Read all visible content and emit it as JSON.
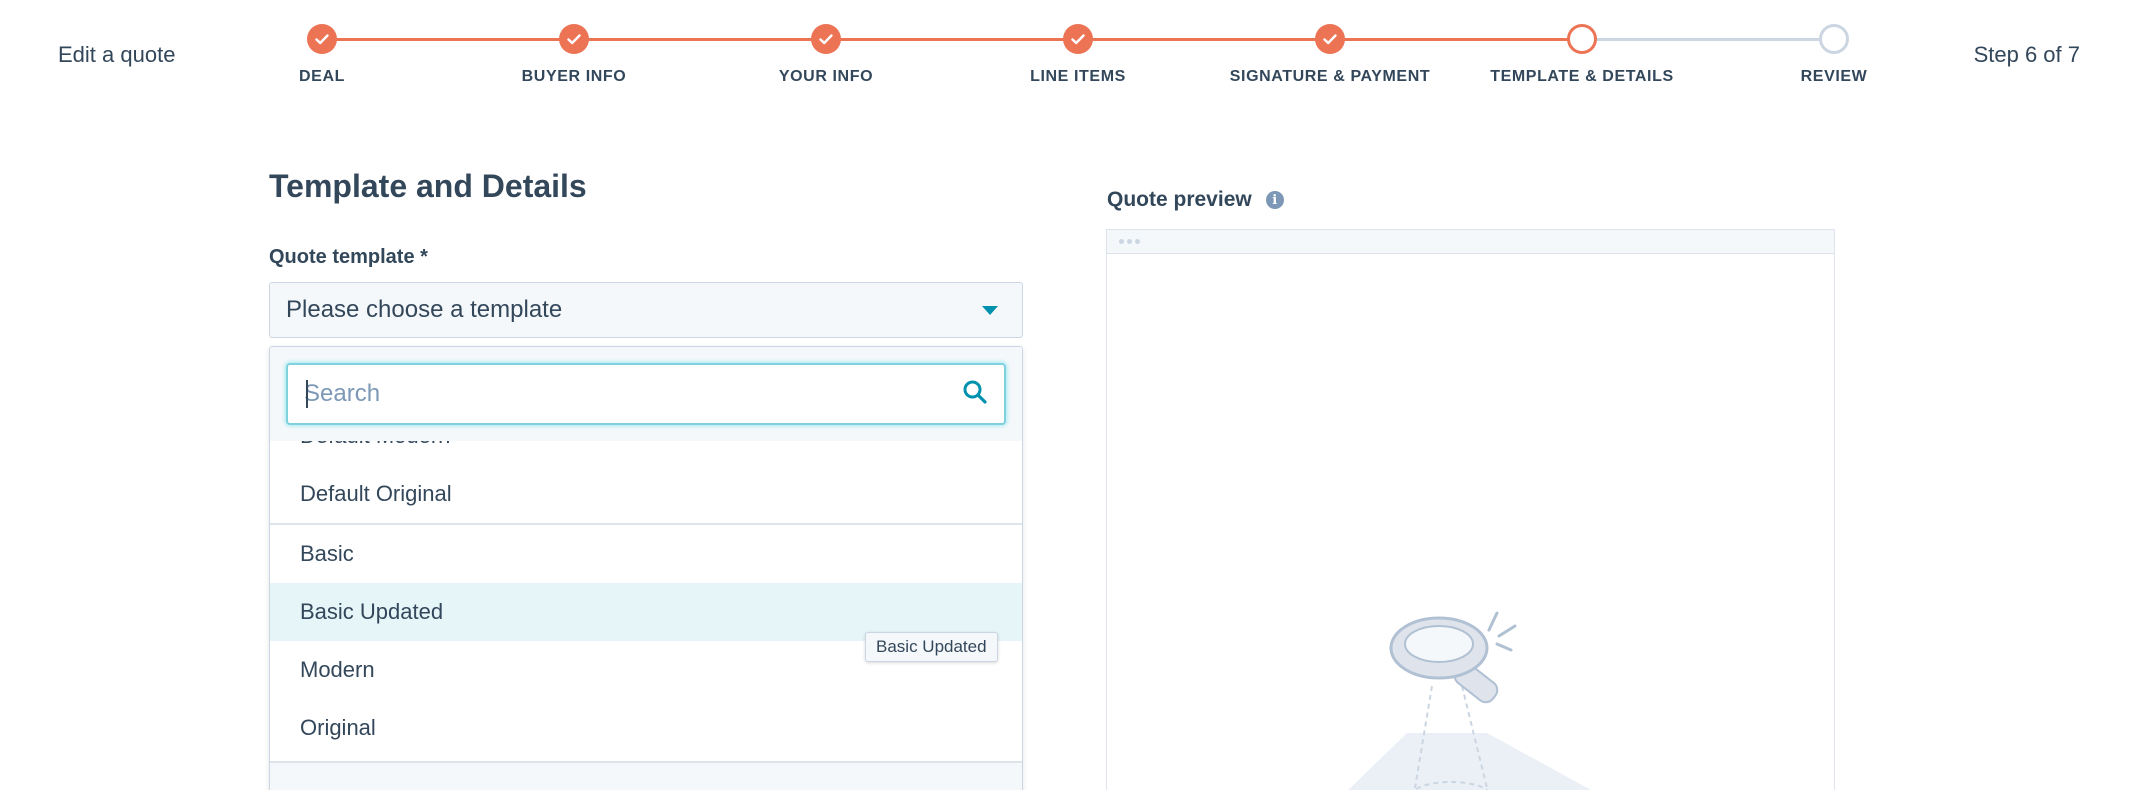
{
  "header": {
    "title": "Edit a quote",
    "step_count": "Step 6 of 7",
    "steps": [
      {
        "label": "DEAL",
        "status": "done"
      },
      {
        "label": "BUYER INFO",
        "status": "done"
      },
      {
        "label": "YOUR INFO",
        "status": "done"
      },
      {
        "label": "LINE ITEMS",
        "status": "done"
      },
      {
        "label": "SIGNATURE & PAYMENT",
        "status": "done"
      },
      {
        "label": "TEMPLATE & DETAILS",
        "status": "current"
      },
      {
        "label": "REVIEW",
        "status": "todo"
      }
    ],
    "accent_color": "#ec7455",
    "pending_color": "#cbd6e2"
  },
  "form": {
    "section_title": "Template and Details",
    "template_label": "Quote template *",
    "template_select_value": "Please choose a template",
    "search_placeholder": "Search",
    "search_value": "",
    "options": [
      {
        "label": "Default Modern",
        "state": "partially-scrolled"
      },
      {
        "label": "Default Original",
        "state": "normal"
      },
      {
        "label": "Basic",
        "state": "normal"
      },
      {
        "label": "Basic Updated",
        "state": "hover"
      },
      {
        "label": "Modern",
        "state": "normal"
      },
      {
        "label": "Original",
        "state": "normal"
      }
    ],
    "tooltip": "Basic Updated"
  },
  "preview": {
    "title": "Quote preview",
    "info_icon": "info-icon"
  }
}
